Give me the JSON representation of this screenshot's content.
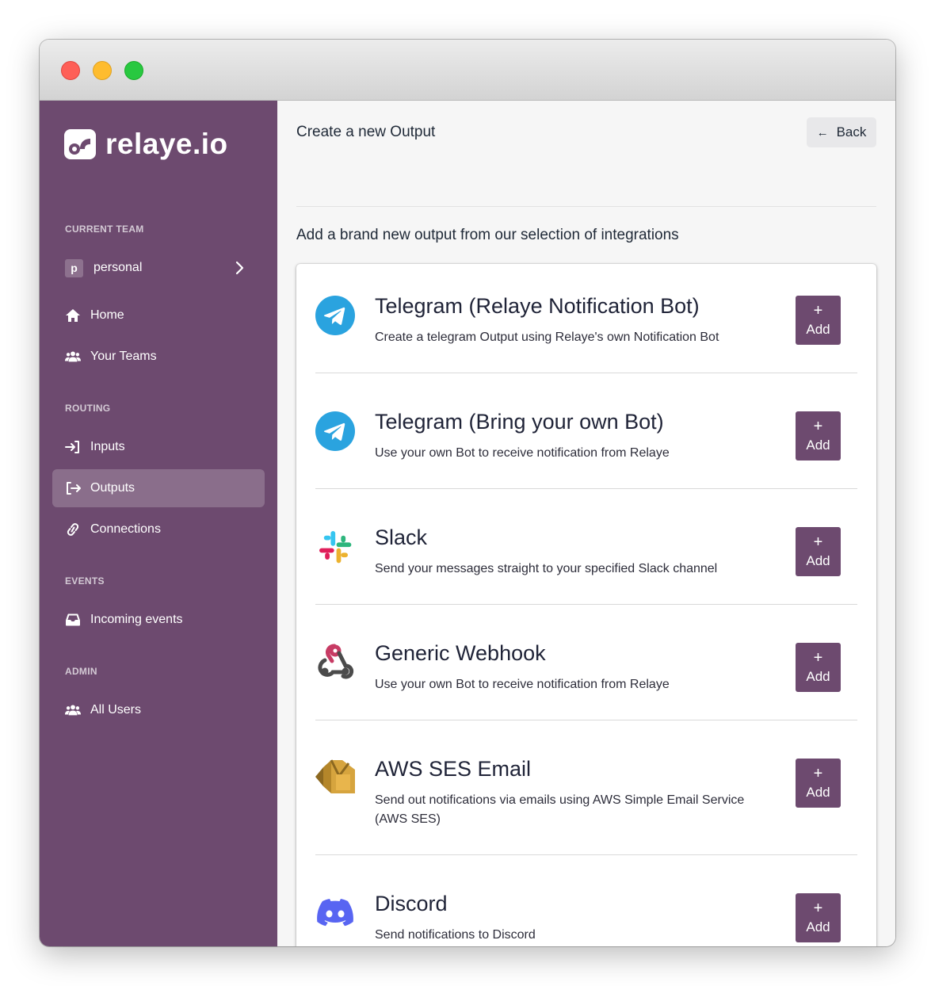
{
  "brand": {
    "name": "relaye.io"
  },
  "sidebar": {
    "current_team_label": "CURRENT TEAM",
    "team": {
      "initial": "p",
      "name": "personal"
    },
    "main_items": [
      {
        "label": "Home",
        "icon": "home-icon"
      },
      {
        "label": "Your Teams",
        "icon": "users-icon"
      }
    ],
    "routing_label": "ROUTING",
    "routing_items": [
      {
        "label": "Inputs",
        "icon": "sign-in-icon"
      },
      {
        "label": "Outputs",
        "icon": "sign-out-icon",
        "active": true
      },
      {
        "label": "Connections",
        "icon": "link-icon"
      }
    ],
    "events_label": "EVENTS",
    "events_items": [
      {
        "label": "Incoming events",
        "icon": "inbox-icon"
      }
    ],
    "admin_label": "ADMIN",
    "admin_items": [
      {
        "label": "All Users",
        "icon": "users-icon"
      }
    ]
  },
  "main": {
    "title": "Create a new Output",
    "back_label": "Back",
    "subtitle": "Add a brand new output from our selection of integrations",
    "add_label": "Add",
    "add_plus": "+",
    "integrations": [
      {
        "title": "Telegram (Relaye Notification Bot)",
        "description": "Create a telegram Output using Relaye's own Notification Bot",
        "icon": "telegram-icon"
      },
      {
        "title": "Telegram (Bring your own Bot)",
        "description": "Use your own Bot to receive notification from Relaye",
        "icon": "telegram-icon"
      },
      {
        "title": "Slack",
        "description": "Send your messages straight to your specified Slack channel",
        "icon": "slack-icon"
      },
      {
        "title": "Generic Webhook",
        "description": "Use your own Bot to receive notification from Relaye",
        "icon": "webhook-icon"
      },
      {
        "title": "AWS SES Email",
        "description": "Send out notifications via emails using AWS Simple Email Service (AWS SES)",
        "icon": "aws-ses-icon"
      },
      {
        "title": "Discord",
        "description": "Send notifications to Discord",
        "icon": "discord-icon"
      }
    ]
  },
  "colors": {
    "sidebar": "#6d4a6f",
    "accent": "#6d4a6f",
    "telegram": "#2aa3df",
    "discord": "#5865f2"
  }
}
